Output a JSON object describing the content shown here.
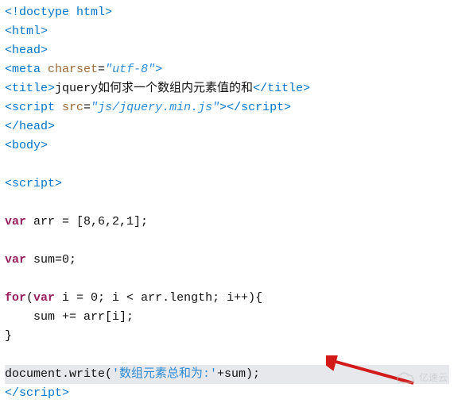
{
  "lines": {
    "l1": {
      "t1": "<!",
      "t2": "doctype html",
      "t3": ">"
    },
    "l2": {
      "t1": "<",
      "t2": "html",
      "t3": ">"
    },
    "l3": {
      "t1": "<",
      "t2": "head",
      "t3": ">"
    },
    "l4": {
      "t1": "<",
      "t2": "meta ",
      "t3": "charset",
      "t4": "=",
      "t5": "\"utf-8\"",
      "t6": ">"
    },
    "l5": {
      "t1": "<",
      "t2": "title",
      "t3": ">",
      "t4": "jquery如何求一个数组内元素值的和",
      "t5": "</",
      "t6": "title",
      "t7": ">"
    },
    "l6": {
      "t1": "<",
      "t2": "script ",
      "t3": "src",
      "t4": "=",
      "t5": "\"js/jquery.min.js\"",
      "t6": ">",
      "t7": "</",
      "t8": "script",
      "t9": ">"
    },
    "l7": {
      "t1": "</",
      "t2": "head",
      "t3": ">"
    },
    "l8": {
      "t1": "<",
      "t2": "body",
      "t3": ">"
    },
    "l10": {
      "t1": "<",
      "t2": "script",
      "t3": ">"
    },
    "l12": {
      "t1": "var",
      "t2": " arr = [8,6,2,1];"
    },
    "l14": {
      "t1": "var",
      "t2": " sum=0;"
    },
    "l16": {
      "t1": "for",
      "t2": "(",
      "t3": "var",
      "t4": " i = 0; i < arr.length; i++){"
    },
    "l17": {
      "t1": "    sum += arr[i];"
    },
    "l18": {
      "t1": "}"
    },
    "l20": {
      "t1": "document.write(",
      "t2": "'数组元素总和为:'",
      "t3": "+sum);"
    },
    "l21": {
      "t1": "</",
      "t2": "script",
      "t3": ">"
    }
  },
  "watermark_text": "亿速云"
}
